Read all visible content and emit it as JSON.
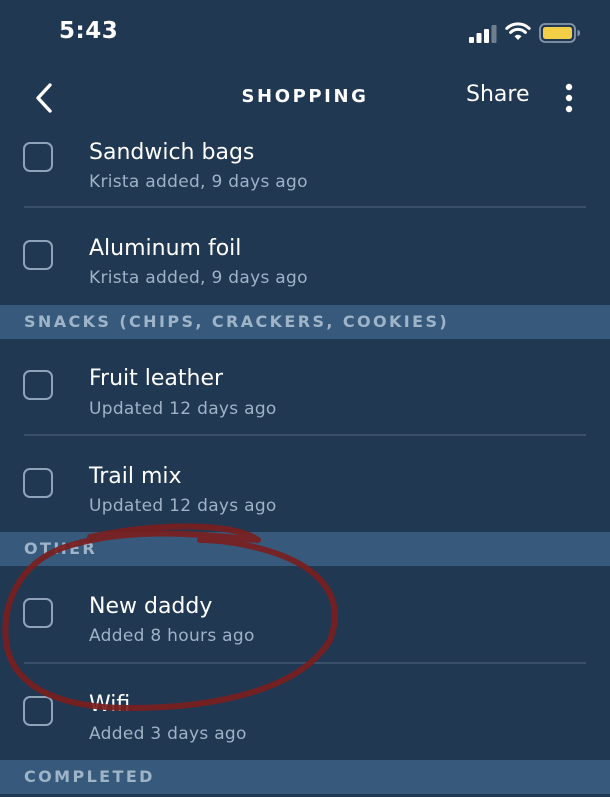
{
  "status_bar": {
    "time": "5:43"
  },
  "header": {
    "title": "SHOPPING",
    "share_label": "Share"
  },
  "items": [
    {
      "title": "Sandwich bags",
      "subtitle": "Krista added, 9 days ago"
    },
    {
      "title": "Aluminum foil",
      "subtitle": "Krista added, 9 days ago"
    },
    {
      "title": "Fruit leather",
      "subtitle": "Updated 12 days ago"
    },
    {
      "title": "Trail mix",
      "subtitle": "Updated 12 days ago"
    },
    {
      "title": "New daddy",
      "subtitle": "Added 8 hours ago"
    },
    {
      "title": "Wifi",
      "subtitle": "Added 3 days ago"
    }
  ],
  "sections": [
    {
      "label": "SNACKS (CHIPS, CRACKERS, COOKIES)"
    },
    {
      "label": "OTHER"
    },
    {
      "label": "COMPLETED"
    }
  ],
  "colors": {
    "background": "#213853",
    "section_background": "#375a7c",
    "annotation_ink": "#7a1e1e",
    "battery": "#f2cf47"
  },
  "icons": {
    "back": "chevron-left-icon",
    "more": "vertical-dots-icon",
    "signal": "cellular-signal-icon",
    "wifi": "wifi-icon",
    "battery": "battery-icon"
  }
}
